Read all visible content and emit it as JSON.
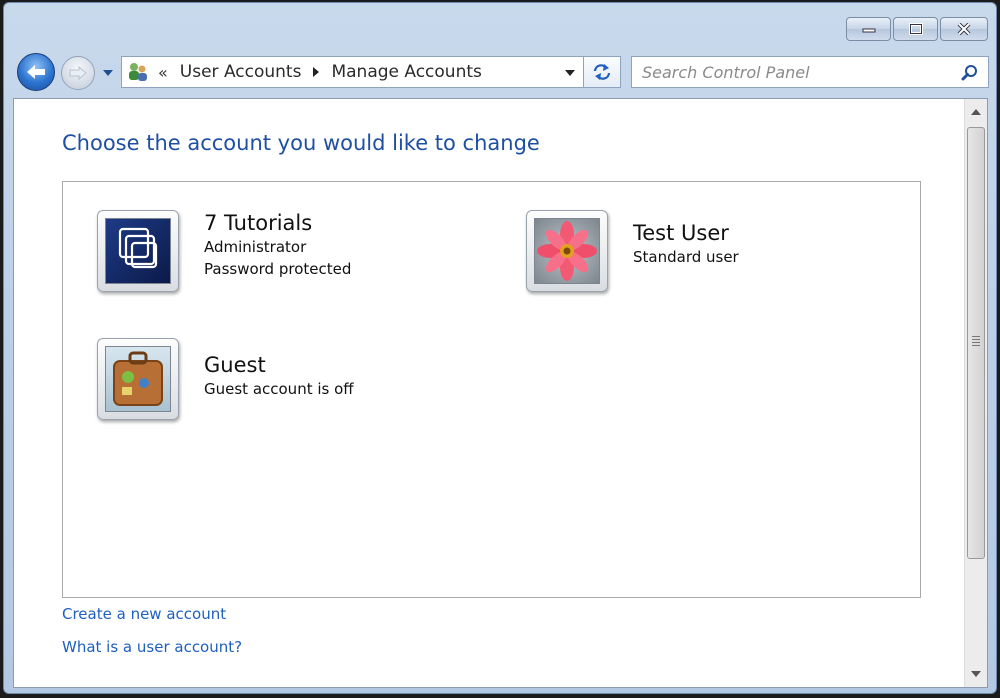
{
  "window": {
    "caption": {
      "minimize": "minimize-icon",
      "maximize": "maximize-icon",
      "close": "close-icon"
    }
  },
  "nav": {
    "back_icon": "back-arrow-icon",
    "forward_icon": "forward-arrow-icon",
    "address": {
      "chevrons": "«",
      "breadcrumbs": [
        "User Accounts",
        "Manage Accounts"
      ]
    },
    "refresh_icon": "refresh-icon",
    "search": {
      "placeholder": "Search Control Panel",
      "icon": "search-icon"
    }
  },
  "main": {
    "heading": "Choose the account you would like to change",
    "accounts": [
      {
        "name": "7 Tutorials",
        "lines": [
          "Administrator",
          "Password protected"
        ],
        "picture": "overlapping-squares-picture"
      },
      {
        "name": "Test User",
        "lines": [
          "Standard user"
        ],
        "picture": "flower-picture"
      },
      {
        "name": "Guest",
        "lines": [
          "Guest account is off"
        ],
        "picture": "suitcase-picture"
      }
    ],
    "links": {
      "create": "Create a new account",
      "what_is": "What is a user account?"
    }
  },
  "colors": {
    "heading": "#1e4fa4",
    "link": "#1e5fbf",
    "frame": "#bcd0e8"
  }
}
